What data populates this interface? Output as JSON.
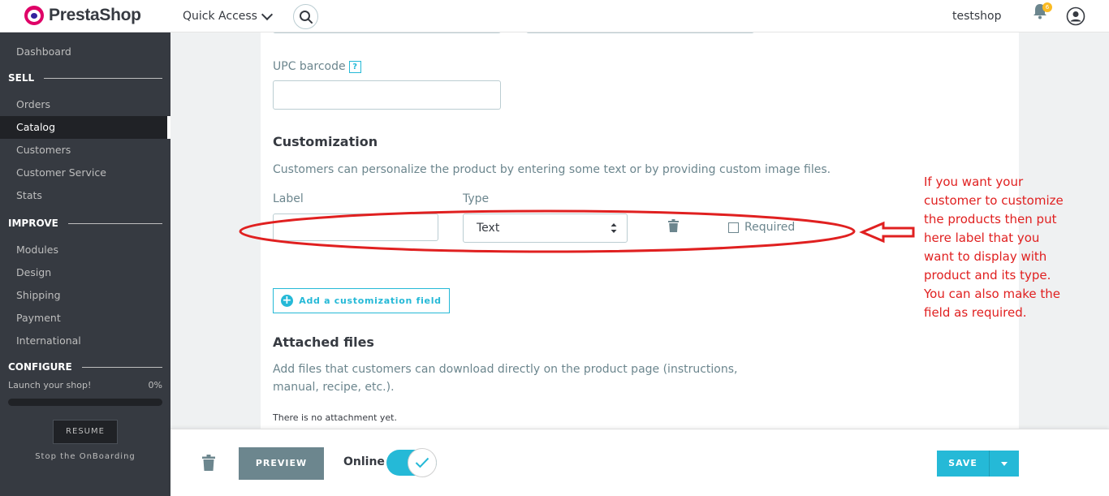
{
  "header": {
    "logo_text": "PrestaShop",
    "quick_access": "Quick Access",
    "shop_name": "testshop",
    "notification_count": "6"
  },
  "sidebar": {
    "dashboard": "Dashboard",
    "sections": {
      "sell": "SELL",
      "improve": "IMPROVE",
      "configure": "CONFIGURE"
    },
    "sell_items": [
      "Orders",
      "Catalog",
      "Customers",
      "Customer Service",
      "Stats"
    ],
    "improve_items": [
      "Modules",
      "Design",
      "Shipping",
      "Payment",
      "International"
    ],
    "active_item": "Catalog",
    "launch_label": "Launch your shop!",
    "launch_progress": "0%",
    "launch_progress_fraction": 0,
    "resume": "RESUME",
    "stop_onboarding": "Stop the OnBoarding"
  },
  "form": {
    "upc_label": "UPC barcode",
    "upc_help": "?",
    "customization_title": "Customization",
    "customization_desc": "Customers can personalize the product by entering some text or by providing custom image files.",
    "label_col": "Label",
    "type_col": "Type",
    "type_value": "Text",
    "required_label": "Required",
    "add_customization": "Add a customization field",
    "attached_title": "Attached files",
    "attached_desc_1": "Add files that customers can download directly on the product page (instructions,",
    "attached_desc_2": "manual, recipe, etc.).",
    "no_attachment": "There is no attachment yet."
  },
  "annotation": {
    "lines": [
      "If you want your",
      "customer to customize",
      "the products then put",
      "here label that you",
      "want to display with",
      "product and its type.",
      "You can also make the",
      "field as required."
    ],
    "color": "#e02020"
  },
  "footer": {
    "preview": "PREVIEW",
    "online": "Online",
    "online_enabled": true,
    "save": "SAVE"
  },
  "colors": {
    "accent": "#25b9d7",
    "sidebar_bg": "#363a41",
    "sidebar_active_bg": "#202226",
    "annotation_red": "#e02020"
  }
}
